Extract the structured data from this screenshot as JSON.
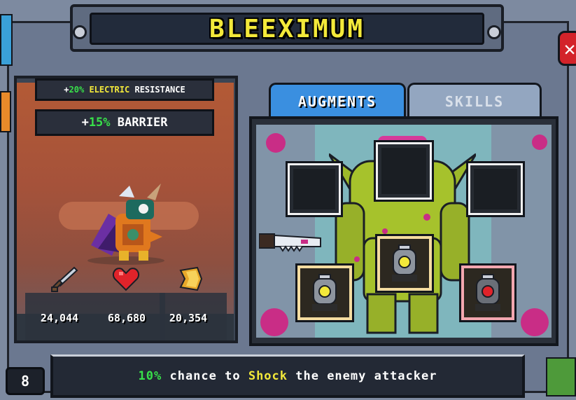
{
  "title": "BLEEXIMUM",
  "bonuses": {
    "electric": {
      "prefix": "+",
      "value": "20%",
      "type": "ELECTRIC",
      "suffix": "RESISTANCE"
    },
    "barrier": {
      "prefix": "+",
      "value": "15%",
      "type": "BARRIER"
    }
  },
  "stats": [
    {
      "icon": "sword-icon",
      "value": "24,044"
    },
    {
      "icon": "heart-icon",
      "value": "68,680"
    },
    {
      "icon": "shield-icon",
      "value": "20,354"
    }
  ],
  "tabs": [
    {
      "label": "AUGMENTS",
      "active": true
    },
    {
      "label": "SKILLS",
      "active": false
    }
  ],
  "level": "8",
  "description": {
    "chance": "10%",
    "pre": " chance to ",
    "keyword": "Shock",
    "post": " the enemy attacker"
  },
  "colors": {
    "title": "#f3e93a",
    "active_tab": "#3a8fe0",
    "inactive_tab": "#93a6c0",
    "highlight_green": "#38e04a",
    "highlight_yellow": "#f3e93a",
    "close": "#d3232a"
  },
  "icons": {
    "close": "close-icon",
    "augment_stone": "augment-stone-icon",
    "saw_blade": "saw-icon"
  }
}
